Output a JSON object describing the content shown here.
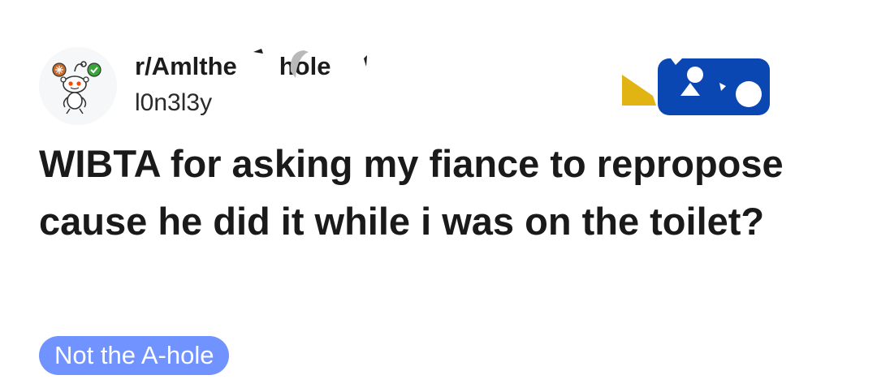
{
  "post": {
    "subreddit": "r/AmItheAsshole",
    "subreddit_visible": "r/Amlthe",
    "subreddit_visible_tail": "hole",
    "author": "l0n3l3y",
    "title": "WIBTA for asking my fiance to repropose cause he did it while i was on the toilet?",
    "flair": "Not the A-hole"
  },
  "icons": {
    "avatar": "reddit-snoo-avatar",
    "badge_left": "orange-award-badge",
    "badge_right": "green-check-badge"
  },
  "colors": {
    "flair_bg": "#7193ff",
    "flair_text": "#ffffff",
    "sticker_blue": "#0b47b3",
    "sticker_yellow": "#e1b413",
    "title_text": "#1a1a1b"
  }
}
